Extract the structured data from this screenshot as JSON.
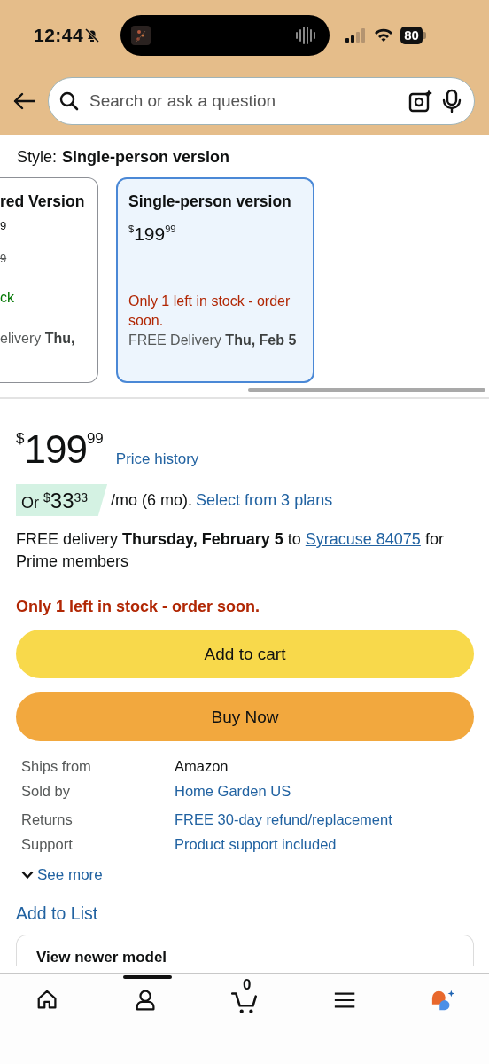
{
  "status_bar": {
    "time": "12:44",
    "battery": "80"
  },
  "search": {
    "placeholder": "Search or ask a question"
  },
  "style": {
    "label": "Style:",
    "value": "Single-person version"
  },
  "style_options": [
    {
      "kind": "clipped",
      "title": "red Version",
      "price": "9",
      "list_price": "9",
      "stock": {
        "text": "ck",
        "color": "#007600"
      },
      "delivery": "elivery **Thu,**",
      "selected": false
    },
    {
      "kind": "full",
      "title": "Single-person version",
      "price": {
        "currency": "$",
        "whole": "199",
        "fraction": "99"
      },
      "stock": {
        "text": "Only 1 left in stock - order soon.",
        "color": "#b12704"
      },
      "delivery": "FREE Delivery **Thu, Feb 5**",
      "selected": true
    }
  ],
  "buy_box": {
    "price": {
      "currency": "$",
      "whole": "199",
      "fraction": "99"
    },
    "price_history": "Price history",
    "installment": {
      "prefix": "Or",
      "currency": "$",
      "whole": "33",
      "fraction": "33",
      "terms": "/mo (6 mo).",
      "link": "Select from 3 plans"
    },
    "delivery": {
      "text": "FREE delivery **Thursday, February 5** to",
      "link": "Syracuse 84075",
      "suffix": "for Prime members"
    },
    "stock": "Only 1 left in stock - order soon.",
    "buttons": [
      {
        "label": "Add to cart",
        "kind": "cart"
      },
      {
        "label": "Buy Now",
        "kind": "buy"
      }
    ]
  },
  "details": [
    {
      "label": "Ships from",
      "value": "Amazon",
      "link": false
    },
    {
      "label": "Sold by",
      "value": "Home Garden US",
      "link": true
    },
    {
      "label": "Returns",
      "value": "FREE 30-day refund/replacement",
      "link": true
    },
    {
      "label": "Support",
      "value": "Product support included",
      "link": true
    }
  ],
  "see_more": "See more",
  "add_to_list": "Add to List",
  "newer_model": "View newer model",
  "nav": [
    {
      "kind": "home"
    },
    {
      "kind": "account"
    },
    {
      "kind": "cart",
      "count": "0"
    },
    {
      "kind": "menu"
    },
    {
      "kind": "assistant"
    }
  ]
}
